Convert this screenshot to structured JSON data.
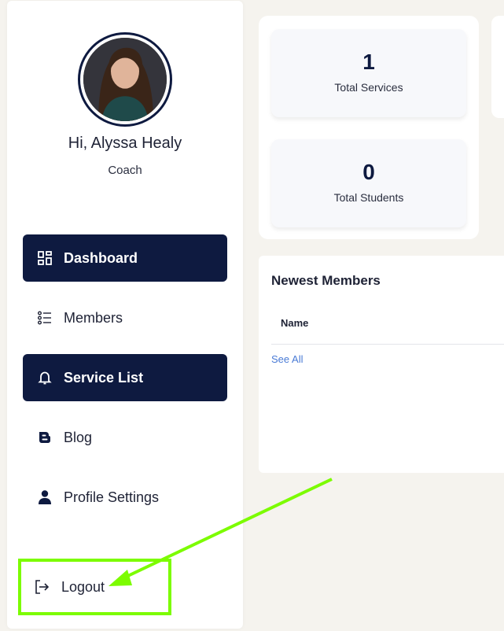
{
  "user": {
    "greeting": "Hi, Alyssa Healy",
    "role": "Coach"
  },
  "sidebar": {
    "items": [
      {
        "label": "Dashboard",
        "icon": "dashboard-icon",
        "active": true
      },
      {
        "label": "Members",
        "icon": "list-icon",
        "active": false
      },
      {
        "label": "Service List",
        "icon": "bell-icon",
        "active": true
      },
      {
        "label": "Blog",
        "icon": "blogger-icon",
        "active": false
      },
      {
        "label": "Profile Settings",
        "icon": "user-icon",
        "active": false
      }
    ],
    "logout": {
      "label": "Logout",
      "icon": "logout-icon"
    }
  },
  "stats": [
    {
      "value": "1",
      "label": "Total Services"
    },
    {
      "value": "0",
      "label": "Total Students"
    }
  ],
  "members": {
    "title": "Newest Members",
    "column_name": "Name",
    "see_all": "See All"
  },
  "colors": {
    "accent": "#0e1a40",
    "link": "#4a7bd6",
    "annotation": "#7cfc00"
  }
}
